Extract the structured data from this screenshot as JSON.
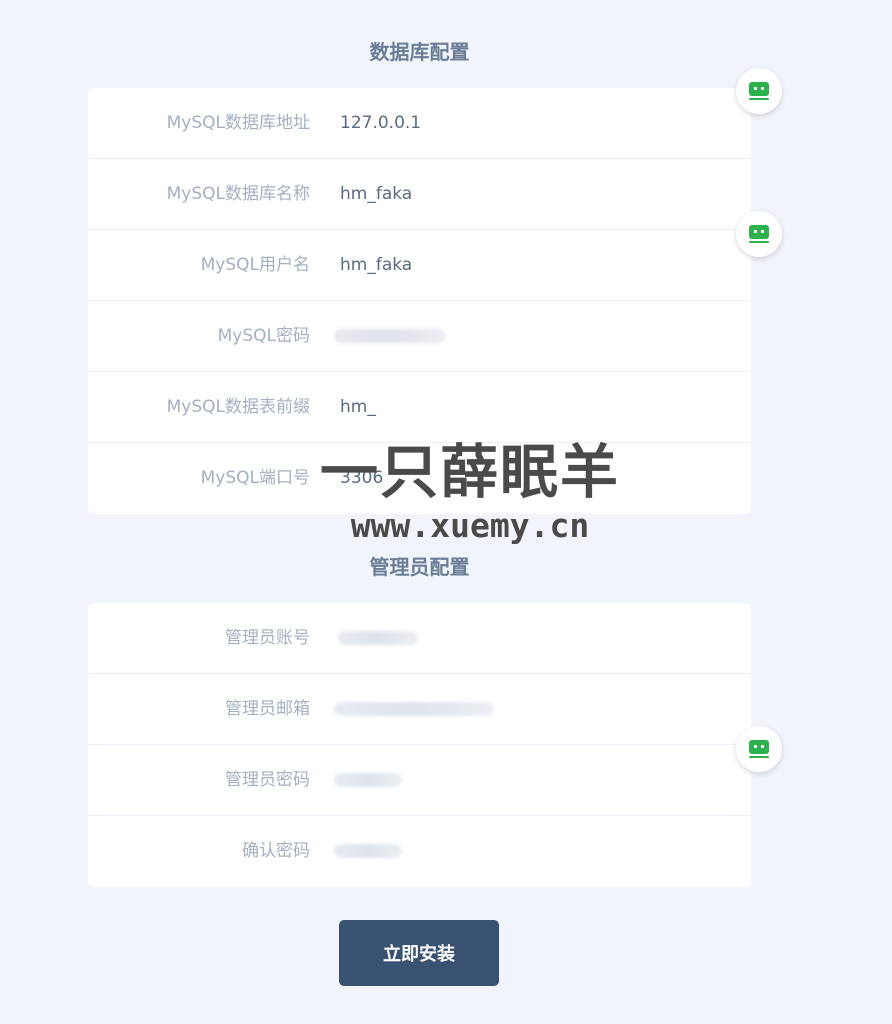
{
  "db_section": {
    "title": "数据库配置",
    "fields": [
      {
        "label": "MySQL数据库地址",
        "value": "127.0.0.1"
      },
      {
        "label": "MySQL数据库名称",
        "value": "hm_faka"
      },
      {
        "label": "MySQL用户名",
        "value": "hm_faka"
      },
      {
        "label": "MySQL密码",
        "value": ""
      },
      {
        "label": "MySQL数据表前缀",
        "value": "hm_"
      },
      {
        "label": "MySQL端口号",
        "value": "3306"
      }
    ]
  },
  "admin_section": {
    "title": "管理员配置",
    "fields": [
      {
        "label": "管理员账号",
        "value": ""
      },
      {
        "label": "管理员邮箱",
        "value": ""
      },
      {
        "label": "管理员密码",
        "value": ""
      },
      {
        "label": "确认密码",
        "value": ""
      }
    ]
  },
  "install_button": {
    "label": "立即安装"
  },
  "watermark": {
    "line1": "一只薛眠羊",
    "line2": "www.xuemy.cn"
  },
  "colors": {
    "background": "#f1f5fb",
    "accent": "#3a5272",
    "label": "#a4b0c2",
    "float_icon": "#2bb24c"
  },
  "icons": {
    "float_button": "password-manager-icon"
  }
}
